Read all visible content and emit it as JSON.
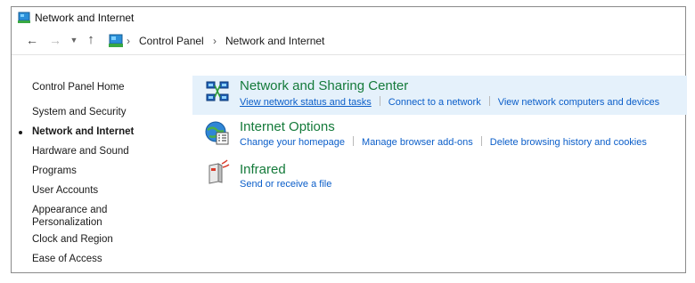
{
  "window": {
    "title": "Network and Internet"
  },
  "nav": {
    "address": [
      "Control Panel",
      "Network and Internet"
    ]
  },
  "sidebar": {
    "items": [
      {
        "label": "Control Panel Home"
      },
      {
        "label": "System and Security"
      },
      {
        "label": "Network and Internet",
        "active": true
      },
      {
        "label": "Hardware and Sound"
      },
      {
        "label": "Programs"
      },
      {
        "label": "User Accounts"
      },
      {
        "label": "Appearance and Personalization"
      },
      {
        "label": "Clock and Region"
      },
      {
        "label": "Ease of Access"
      }
    ]
  },
  "categories": [
    {
      "icon": "network-sharing-icon",
      "title": "Network and Sharing Center",
      "links": [
        "View network status and tasks",
        "Connect to a network",
        "View network computers and devices"
      ]
    },
    {
      "icon": "internet-options-icon",
      "title": "Internet Options",
      "links": [
        "Change your homepage",
        "Manage browser add-ons",
        "Delete browsing history and cookies"
      ]
    },
    {
      "icon": "infrared-icon",
      "title": "Infrared",
      "links": [
        "Send or receive a file"
      ]
    }
  ]
}
